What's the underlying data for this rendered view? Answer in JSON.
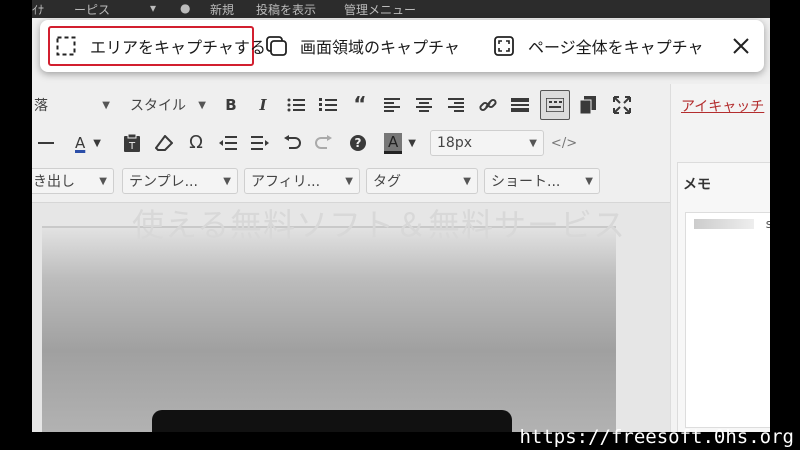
{
  "wp_topbar": {
    "items": [
      "ｲﾅ",
      "ーピス",
      "▾",
      "●",
      "新規",
      "投稿を表示",
      "管理メニュー"
    ]
  },
  "toolbar": {
    "row1": {
      "format_label": "落",
      "style_label": "スタイル",
      "icons": [
        "bold-icon",
        "italic-icon",
        "bullet-list-icon",
        "numbered-list-icon",
        "blockquote-icon",
        "align-left-icon",
        "align-center-icon",
        "align-right-icon",
        "link-icon",
        "more-tag-icon",
        "toolbar-toggle-icon",
        "copy-icon",
        "fullscreen-icon"
      ],
      "bold": "B",
      "italic": "I"
    },
    "row2": {
      "font_size_value": "18px",
      "icons": [
        "horizontal-rule-icon",
        "text-color-icon",
        "paste-text-icon",
        "clear-format-icon",
        "omega-icon",
        "outdent-icon",
        "indent-icon",
        "undo-icon",
        "redo-icon",
        "help-icon",
        "background-color-icon",
        "code-icon"
      ],
      "text_color_letter": "A",
      "bg_color_letter": "A",
      "omega": "Ω"
    },
    "row3": {
      "dropdowns": [
        "き出し",
        "テンプレ...",
        "アフィリ...",
        "タグ",
        "ショート..."
      ]
    }
  },
  "editor": {
    "watermark": "使える無料ソフト＆無料サービス"
  },
  "sidebar": {
    "eyecatch_link": "アイキャッチ",
    "memo_title": "メモ",
    "memo_fragment": "s"
  },
  "capture_bar": {
    "area_label": "エリアをキャプチャする",
    "region_label": "画面領域のキャプチャ",
    "fullpage_label": "ページ全体をキャプチャ",
    "selected_color": "#d21f2f"
  },
  "site_url": "https://freesoft.0hs.org"
}
